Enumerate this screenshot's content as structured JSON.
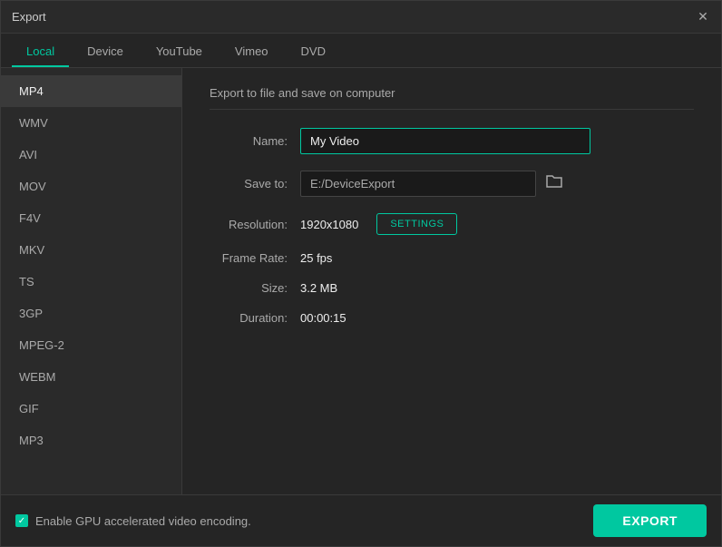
{
  "window": {
    "title": "Export",
    "close_icon": "✕"
  },
  "tabs": [
    {
      "id": "local",
      "label": "Local",
      "active": true
    },
    {
      "id": "device",
      "label": "Device",
      "active": false
    },
    {
      "id": "youtube",
      "label": "YouTube",
      "active": false
    },
    {
      "id": "vimeo",
      "label": "Vimeo",
      "active": false
    },
    {
      "id": "dvd",
      "label": "DVD",
      "active": false
    }
  ],
  "sidebar": {
    "items": [
      {
        "id": "mp4",
        "label": "MP4",
        "active": true
      },
      {
        "id": "wmv",
        "label": "WMV",
        "active": false
      },
      {
        "id": "avi",
        "label": "AVI",
        "active": false
      },
      {
        "id": "mov",
        "label": "MOV",
        "active": false
      },
      {
        "id": "f4v",
        "label": "F4V",
        "active": false
      },
      {
        "id": "mkv",
        "label": "MKV",
        "active": false
      },
      {
        "id": "ts",
        "label": "TS",
        "active": false
      },
      {
        "id": "3gp",
        "label": "3GP",
        "active": false
      },
      {
        "id": "mpeg2",
        "label": "MPEG-2",
        "active": false
      },
      {
        "id": "webm",
        "label": "WEBM",
        "active": false
      },
      {
        "id": "gif",
        "label": "GIF",
        "active": false
      },
      {
        "id": "mp3",
        "label": "MP3",
        "active": false
      }
    ]
  },
  "main": {
    "section_title": "Export to file and save on computer",
    "fields": {
      "name_label": "Name:",
      "name_value": "My Video",
      "save_to_label": "Save to:",
      "save_to_value": "E:/DeviceExport",
      "resolution_label": "Resolution:",
      "resolution_value": "1920x1080",
      "settings_btn_label": "SETTINGS",
      "frame_rate_label": "Frame Rate:",
      "frame_rate_value": "25 fps",
      "size_label": "Size:",
      "size_value": "3.2 MB",
      "duration_label": "Duration:",
      "duration_value": "00:00:15"
    }
  },
  "footer": {
    "gpu_label": "Enable GPU accelerated video encoding.",
    "export_btn_label": "EXPORT",
    "folder_icon": "🗁"
  }
}
